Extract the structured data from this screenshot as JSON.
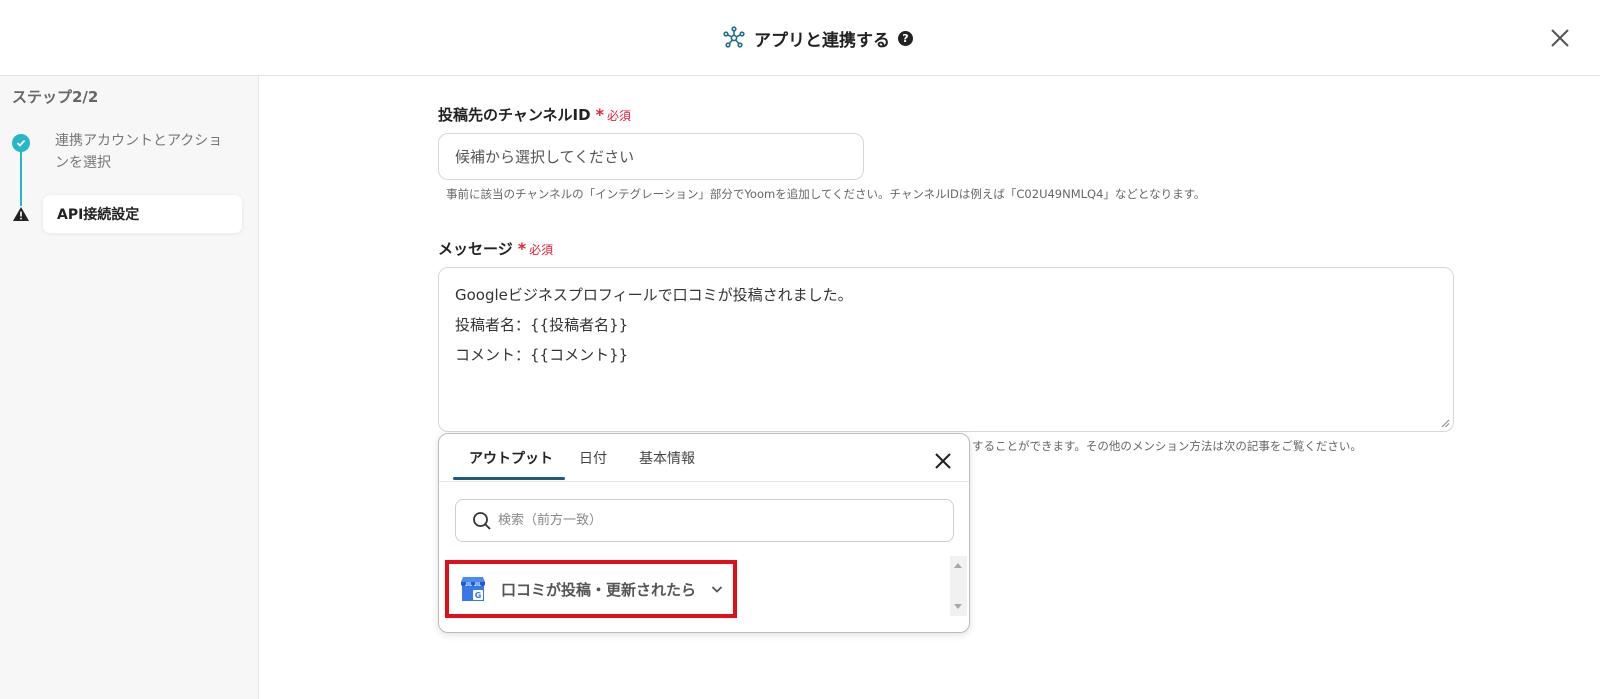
{
  "header": {
    "title": "アプリと連携する",
    "help_icon": "?"
  },
  "sidebar": {
    "step_label": "ステップ2/2",
    "steps": [
      {
        "label": "連携アカウントとアクションを選択",
        "status": "done"
      },
      {
        "label": "API接続設定",
        "status": "warning"
      }
    ]
  },
  "form": {
    "channel": {
      "label": "投稿先のチャンネルID",
      "required": "必須",
      "value": "候補から選択してください",
      "hint": "事前に該当のチャンネルの「インテグレーション」部分でYoomを追加してください。チャンネルIDは例えば「C02U49NMLQ4」などとなります。"
    },
    "message": {
      "label": "メッセージ",
      "required": "必須",
      "lines": [
        "Googleビジネスプロフィールで口コミが投稿されました。",
        "投稿者名：{{投稿者名}}",
        "コメント：{{コメント}}"
      ],
      "hint_tail": "することができます。その他のメンション方法は次の記事をご覧ください。"
    }
  },
  "popup": {
    "tabs": [
      "アウトプット",
      "日付",
      "基本情報"
    ],
    "active_tab": 0,
    "search_placeholder": "検索（前方一致）",
    "items": [
      {
        "label": "口コミが投稿・更新されたら",
        "icon": "google-business-profile-icon"
      }
    ]
  },
  "colors": {
    "accent": "#27b7c8",
    "required": "#e0203a",
    "highlight": "#e0101a",
    "tab_underline": "#1d5d7a"
  }
}
